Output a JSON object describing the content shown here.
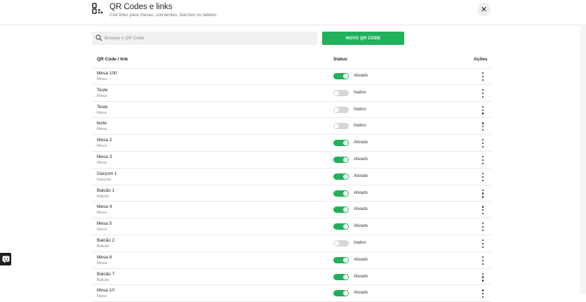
{
  "header": {
    "title": "QR Codes e links",
    "subtitle": "Crie links para mesas, comandas, balcões ou tablets.",
    "close_icon": "close-icon"
  },
  "search": {
    "placeholder": "Busque o QR Code",
    "value": ""
  },
  "new_button": "NOVO QR CODE",
  "table": {
    "headers": {
      "name": "QR Code / link",
      "status": "Status",
      "actions": "Ações"
    },
    "rows": [
      {
        "name": "Mesa 100",
        "type": "Mesa",
        "active": true,
        "status": "Ativado"
      },
      {
        "name": "Teste",
        "type": "Mesa",
        "active": false,
        "status": "Inativo"
      },
      {
        "name": "Teste",
        "type": "Mesa",
        "active": false,
        "status": "Inativo"
      },
      {
        "name": "teste",
        "type": "Mesa",
        "active": false,
        "status": "Inativo"
      },
      {
        "name": "Mesa 2",
        "type": "Mesa",
        "active": true,
        "status": "Ativado"
      },
      {
        "name": "Mesa 3",
        "type": "Mesa",
        "active": true,
        "status": "Ativado"
      },
      {
        "name": "Garçom 1",
        "type": "Garçom",
        "active": true,
        "status": "Ativado"
      },
      {
        "name": "Balcão 1",
        "type": "Balcão",
        "active": true,
        "status": "Ativado"
      },
      {
        "name": "Mesa 4",
        "type": "Mesa",
        "active": true,
        "status": "Ativado"
      },
      {
        "name": "Mesa 5",
        "type": "Mesa",
        "active": true,
        "status": "Ativado"
      },
      {
        "name": "Balcão 2",
        "type": "Balcão",
        "active": false,
        "status": "Inativo"
      },
      {
        "name": "Mesa 6",
        "type": "Mesa",
        "active": true,
        "status": "Ativado"
      },
      {
        "name": "Balcão 7",
        "type": "Balcão",
        "active": true,
        "status": "Ativado"
      },
      {
        "name": "Mesa 10",
        "type": "Mesa",
        "active": true,
        "status": "Ativado"
      }
    ]
  },
  "colors": {
    "accent": "#21b15a",
    "toggle_off": "#d6d6d6"
  }
}
